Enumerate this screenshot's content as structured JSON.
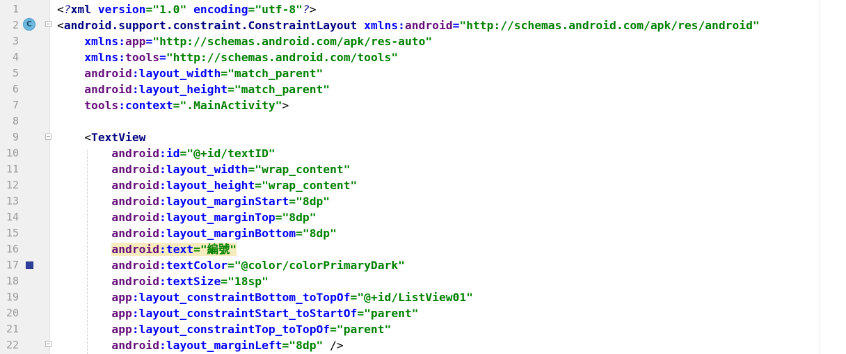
{
  "editor": {
    "class_marker": "C",
    "color_swatch": "#303F9F",
    "lines": [
      [
        [
          "b",
          "<"
        ],
        [
          "xi",
          "?"
        ],
        [
          "t",
          "xml "
        ],
        [
          "a",
          "version"
        ],
        [
          "s",
          "=\"1.0\""
        ],
        [
          "a",
          " encoding"
        ],
        [
          "s",
          "=\"utf-8\""
        ],
        [
          "xi",
          "?"
        ],
        [
          "b",
          ">"
        ]
      ],
      [
        [
          "b",
          "<"
        ],
        [
          "t",
          "android.support.constraint.ConstraintLayout "
        ],
        [
          "a",
          "xmlns:"
        ],
        [
          "p",
          "android"
        ],
        [
          "a",
          "="
        ],
        [
          "s",
          "\"http://schemas.android.com/apk/res/android\""
        ]
      ],
      [
        [
          "b",
          "    "
        ],
        [
          "a",
          "xmlns:"
        ],
        [
          "p",
          "app"
        ],
        [
          "a",
          "="
        ],
        [
          "s",
          "\"http://schemas.android.com/apk/res-auto\""
        ]
      ],
      [
        [
          "b",
          "    "
        ],
        [
          "a",
          "xmlns:"
        ],
        [
          "p",
          "tools"
        ],
        [
          "a",
          "="
        ],
        [
          "s",
          "\"http://schemas.android.com/tools\""
        ]
      ],
      [
        [
          "b",
          "    "
        ],
        [
          "p",
          "android"
        ],
        [
          "a",
          ":layout_width"
        ],
        [
          "s",
          "=\"match_parent\""
        ]
      ],
      [
        [
          "b",
          "    "
        ],
        [
          "p",
          "android"
        ],
        [
          "a",
          ":layout_height"
        ],
        [
          "s",
          "=\"match_parent\""
        ]
      ],
      [
        [
          "b",
          "    "
        ],
        [
          "p",
          "tools"
        ],
        [
          "a",
          ":context"
        ],
        [
          "s",
          "=\".MainActivity\""
        ],
        [
          "b",
          ">"
        ]
      ],
      [],
      [
        [
          "b",
          "    <"
        ],
        [
          "t",
          "TextView"
        ]
      ],
      [
        [
          "b",
          "        "
        ],
        [
          "p",
          "android"
        ],
        [
          "a",
          ":id"
        ],
        [
          "s",
          "=\"@+id/textID\""
        ]
      ],
      [
        [
          "b",
          "        "
        ],
        [
          "p",
          "android"
        ],
        [
          "a",
          ":layout_width"
        ],
        [
          "s",
          "=\"wrap_content\""
        ]
      ],
      [
        [
          "b",
          "        "
        ],
        [
          "p",
          "android"
        ],
        [
          "a",
          ":layout_height"
        ],
        [
          "s",
          "=\"wrap_content\""
        ]
      ],
      [
        [
          "b",
          "        "
        ],
        [
          "p",
          "android"
        ],
        [
          "a",
          ":layout_marginStart"
        ],
        [
          "s",
          "=\"8dp\""
        ]
      ],
      [
        [
          "b",
          "        "
        ],
        [
          "p",
          "android"
        ],
        [
          "a",
          ":layout_marginTop"
        ],
        [
          "s",
          "=\"8dp\""
        ]
      ],
      [
        [
          "b",
          "        "
        ],
        [
          "p",
          "android"
        ],
        [
          "a",
          ":layout_marginBottom"
        ],
        [
          "s",
          "=\"8dp\""
        ]
      ],
      [
        [
          "b",
          "        "
        ],
        [
          "p hl",
          "android"
        ],
        [
          "a hl",
          ":text"
        ],
        [
          "s hl",
          "=\"編號\""
        ]
      ],
      [
        [
          "b",
          "        "
        ],
        [
          "p",
          "android"
        ],
        [
          "a",
          ":textColor"
        ],
        [
          "s",
          "=\"@color/colorPrimaryDark\""
        ]
      ],
      [
        [
          "b",
          "        "
        ],
        [
          "p",
          "android"
        ],
        [
          "a",
          ":textSize"
        ],
        [
          "s",
          "=\"18sp\""
        ]
      ],
      [
        [
          "b",
          "        "
        ],
        [
          "p",
          "app"
        ],
        [
          "a",
          ":layout_constraintBottom_toTopOf"
        ],
        [
          "s",
          "=\"@+id/ListView01\""
        ]
      ],
      [
        [
          "b",
          "        "
        ],
        [
          "p",
          "app"
        ],
        [
          "a",
          ":layout_constraintStart_toStartOf"
        ],
        [
          "s",
          "=\"parent\""
        ]
      ],
      [
        [
          "b",
          "        "
        ],
        [
          "p",
          "app"
        ],
        [
          "a",
          ":layout_constraintTop_toTopOf"
        ],
        [
          "s",
          "=\"parent\""
        ]
      ],
      [
        [
          "b",
          "        "
        ],
        [
          "p",
          "android"
        ],
        [
          "a",
          ":layout_marginLeft"
        ],
        [
          "s",
          "=\"8dp\""
        ],
        [
          "b",
          " />"
        ]
      ]
    ]
  }
}
